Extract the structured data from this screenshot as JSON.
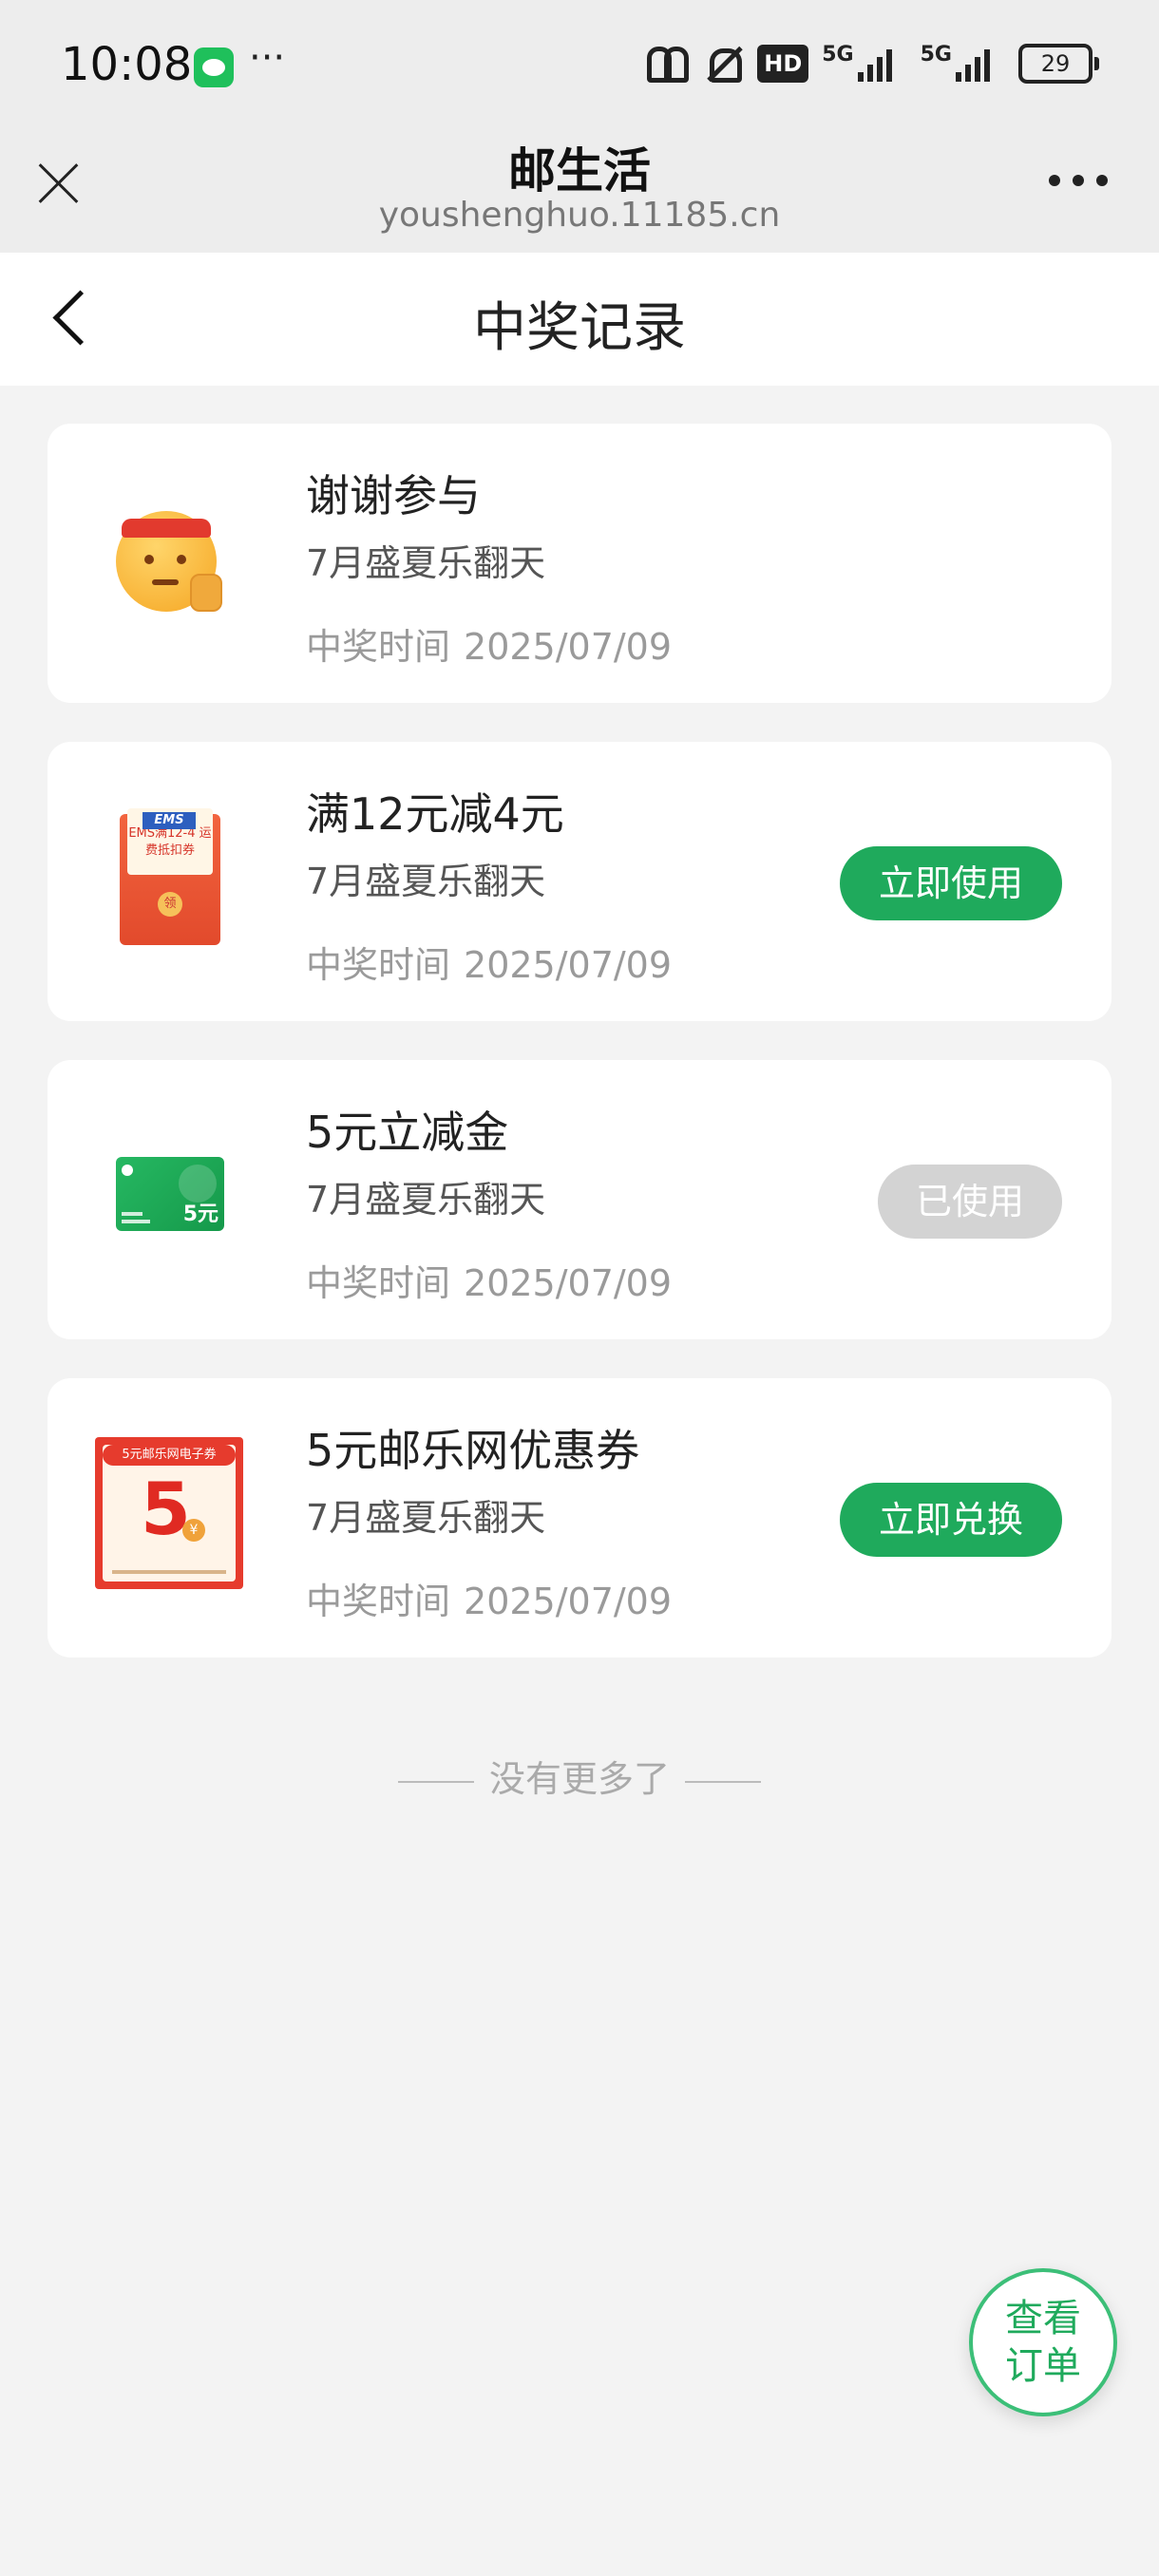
{
  "status_bar": {
    "time": "10:08",
    "more": "···",
    "hd": "HD",
    "network1": "5G",
    "network2": "5G",
    "battery": "29"
  },
  "webview": {
    "title": "邮生活",
    "url": "youshenghuo.11185.cn"
  },
  "header": {
    "title": "中奖记录"
  },
  "records": [
    {
      "title": "谢谢参与",
      "subtitle": "7月盛夏乐翻天",
      "time_label": "中奖时间",
      "time_value": "2025/07/09",
      "thumb": "thanks-emoji-icon",
      "action": ""
    },
    {
      "title": "满12元减4元",
      "subtitle": "7月盛夏乐翻天",
      "time_label": "中奖时间",
      "time_value": "2025/07/09",
      "thumb": "ems-red-envelope-icon",
      "thumb_logo": "EMS",
      "thumb_text": "EMS满12-4 运费抵扣券",
      "thumb_seal": "领",
      "action": "立即使用"
    },
    {
      "title": "5元立减金",
      "subtitle": "7月盛夏乐翻天",
      "time_label": "中奖时间",
      "time_value": "2025/07/09",
      "thumb": "green-card-icon",
      "thumb_amount": "5元",
      "action": "已使用"
    },
    {
      "title": "5元邮乐网优惠券",
      "subtitle": "7月盛夏乐翻天",
      "time_label": "中奖时间",
      "time_value": "2025/07/09",
      "thumb": "coupon-icon",
      "thumb_head": "5元邮乐网电子券",
      "thumb_big": "5",
      "thumb_yen": "¥",
      "action": "立即兑换"
    }
  ],
  "footer": {
    "no_more": "没有更多了"
  },
  "fab": {
    "line1": "查看",
    "line2": "订单"
  },
  "colors": {
    "primary": "#1faa5c",
    "disabled": "#d3d3d3",
    "background": "#f3f3f3"
  }
}
